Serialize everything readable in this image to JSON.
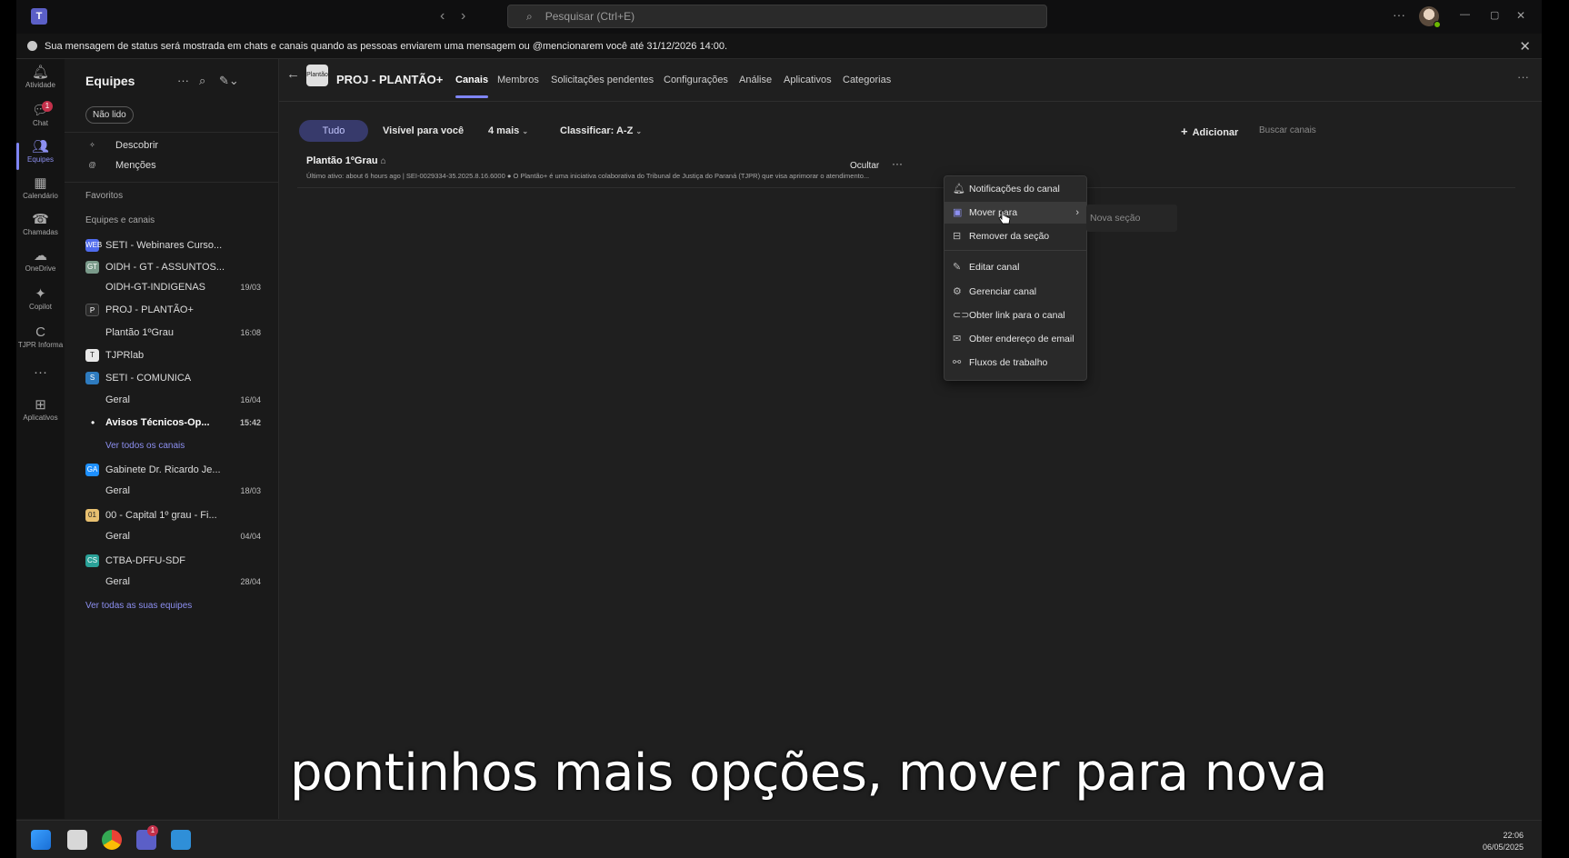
{
  "titlebar": {
    "search_placeholder": "Pesquisar (Ctrl+E)",
    "more": "···",
    "minimize": "—",
    "restore": "▢",
    "close": "✕"
  },
  "banner": {
    "text": "Sua mensagem de status será mostrada em chats e canais quando as pessoas enviarem uma mensagem ou @mencionarem você até 31/12/2026 14:00."
  },
  "rail": {
    "items": [
      {
        "label": "Atividade",
        "icon": "bell-icon"
      },
      {
        "label": "Chat",
        "icon": "chat-icon",
        "badge": "1"
      },
      {
        "label": "Equipes",
        "icon": "teams-icon"
      },
      {
        "label": "Calendário",
        "icon": "calendar-icon"
      },
      {
        "label": "Chamadas",
        "icon": "phone-icon"
      },
      {
        "label": "OneDrive",
        "icon": "cloud-icon"
      },
      {
        "label": "Copilot",
        "icon": "copilot-icon"
      },
      {
        "label": "TJPR Informa",
        "icon": "tjpr-icon"
      },
      {
        "label": "···",
        "icon": "more-icon"
      },
      {
        "label": "Aplicativos",
        "icon": "apps-icon"
      }
    ]
  },
  "teams_panel": {
    "title": "Equipes",
    "filter_chip": "Não lido",
    "discover": "Descobrir",
    "mentions": "Menções",
    "favorites_label": "Favoritos",
    "teams_channels_label": "Equipes e canais",
    "teams": [
      {
        "name": "SETI - Webinares Curso...",
        "icon_color": "#4f6bed",
        "icon_text": "WEB"
      },
      {
        "name": "OIDH - GT - ASSUNTOS...",
        "icon_color": "#7a9a8a",
        "icon_text": "GT"
      },
      {
        "name": "OIDH-GT-INDIGENAS",
        "time": "19/03",
        "channel": true
      },
      {
        "name": "PROJ - PLANTÃO+",
        "icon_color": "#2a2a2a",
        "icon_text": "P"
      },
      {
        "name": "Plantão 1ºGrau",
        "time": "16:08",
        "channel": true
      },
      {
        "name": "TJPRlab",
        "icon_color": "#e8e8e8",
        "icon_text": "T"
      },
      {
        "name": "SETI - COMUNICA",
        "icon_color": "#2e7bbf",
        "icon_text": "S"
      },
      {
        "name": "Geral",
        "time": "16/04",
        "channel": true
      },
      {
        "name": "Avisos Técnicos-Op...",
        "time": "15:42",
        "channel": true,
        "bold": true
      },
      {
        "name": "Ver todos os canais",
        "link": true
      },
      {
        "name": "Gabinete Dr. Ricardo Je...",
        "icon_color": "#1e90ff",
        "icon_text": "GA"
      },
      {
        "name": "Geral",
        "time": "18/03",
        "channel": true
      },
      {
        "name": "00 - Capital 1º grau - Fi...",
        "icon_color": "#e8c070",
        "icon_text": "01"
      },
      {
        "name": "Geral",
        "time": "04/04",
        "channel": true
      },
      {
        "name": "CTBA-DFFU-SDF",
        "icon_color": "#2aa198",
        "icon_text": "CS"
      },
      {
        "name": "Geral",
        "time": "28/04",
        "channel": true
      }
    ],
    "see_all_teams": "Ver todas as suas equipes"
  },
  "main": {
    "team_name": "PROJ - PLANTÃO+",
    "team_avatar_text": "Plantão",
    "tabs": [
      "Canais",
      "Membros",
      "Solicitações pendentes",
      "Configurações",
      "Análise",
      "Aplicativos",
      "Categorias"
    ],
    "filters": {
      "all": "Tudo",
      "visible": "Visível para você",
      "more": "4 mais",
      "sort": "Classificar: A-Z"
    },
    "add": "Adicionar",
    "find_channels": "Buscar canais",
    "channel": {
      "name": "Plantão 1ºGrau",
      "meta": "Último ativo: about 6 hours ago  |  SEI-0029334-35.2025.8.16.6000 ● O Plantão+ é uma iniciativa colaborativa do Tribunal de Justiça do Paraná (TJPR) que visa aprimorar o atendimento...",
      "hide": "Ocultar",
      "more": "···"
    }
  },
  "context_menu": {
    "items": [
      {
        "label": "Notificações do canal",
        "icon": "bell-icon"
      },
      {
        "label": "Mover para",
        "icon": "move-icon",
        "submenu": true,
        "hover": true
      },
      {
        "label": "Remover da seção",
        "icon": "remove-section-icon"
      },
      {
        "label": "Editar canal",
        "icon": "pencil-icon"
      },
      {
        "label": "Gerenciar canal",
        "icon": "gear-icon"
      },
      {
        "label": "Obter link para o canal",
        "icon": "link-icon"
      },
      {
        "label": "Obter endereço de email",
        "icon": "mail-icon"
      },
      {
        "label": "Fluxos de trabalho",
        "icon": "workflow-icon"
      }
    ],
    "submenu_item": "Nova seção"
  },
  "caption": "pontinhos mais opções, mover para nova",
  "taskbar": {
    "time": "22:06",
    "date": "06/05/2025",
    "teams_badge": "1"
  },
  "colors": {
    "accent": "#7f85f5",
    "pill_bg": "#373a6b",
    "badge": "#c4314b"
  }
}
